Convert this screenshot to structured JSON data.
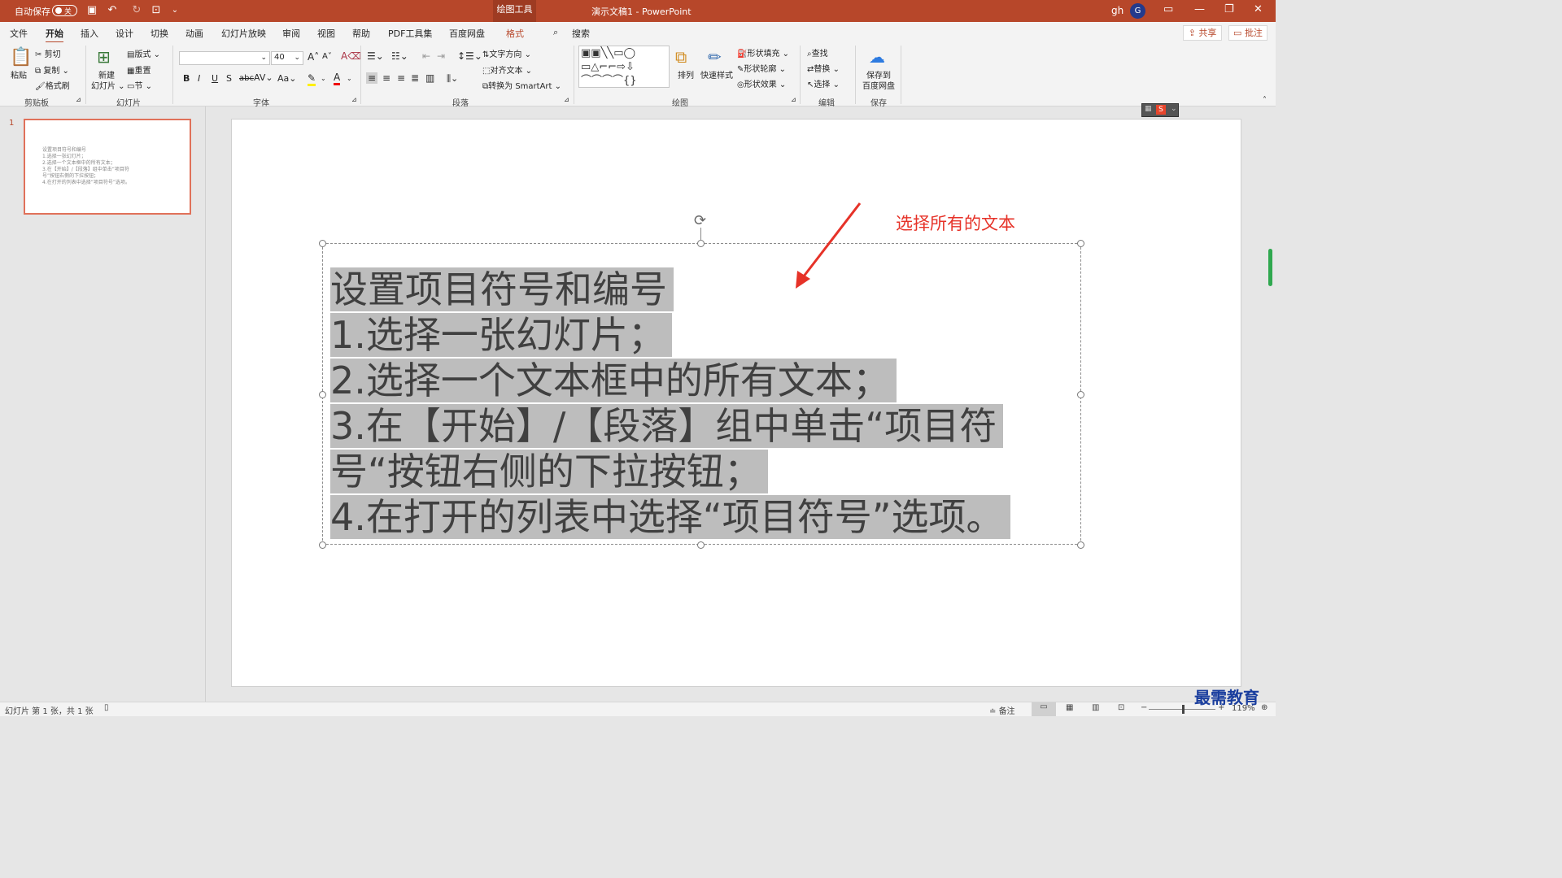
{
  "titlebar": {
    "autosave": "自动保存",
    "toggle": "关",
    "draw_tools": "绘图工具",
    "doc_title": "演示文稿1  -  PowerPoint",
    "user": "gh",
    "avatar": "G"
  },
  "tabs": [
    "文件",
    "开始",
    "插入",
    "设计",
    "切换",
    "动画",
    "幻灯片放映",
    "审阅",
    "视图",
    "帮助",
    "PDF工具集",
    "百度网盘",
    "格式"
  ],
  "search_label": "搜索",
  "share_label": "共享",
  "comment_label": "批注",
  "ribbon": {
    "clipboard": {
      "paste": "粘贴",
      "cut": "剪切",
      "copy": "复制",
      "format_painter": "格式刷",
      "group": "剪贴板"
    },
    "slides": {
      "new_slide_1": "新建",
      "new_slide_2": "幻灯片",
      "layout": "版式",
      "reset": "重置",
      "section": "节",
      "group": "幻灯片"
    },
    "font": {
      "size": "40",
      "group": "字体",
      "bold": "B",
      "italic": "I",
      "underline": "U",
      "shadow": "S",
      "strike": "abc",
      "spacing": "AV",
      "case": "Aa",
      "grow": "A",
      "shrink": "A"
    },
    "paragraph": {
      "text_direction": "文字方向",
      "align_text": "对齐文本",
      "smartart": "转换为 SmartArt",
      "group": "段落"
    },
    "drawing": {
      "arrange": "排列",
      "quick_styles": "快速样式",
      "fill": "形状填充",
      "outline": "形状轮廓",
      "effects": "形状效果",
      "group": "绘图"
    },
    "editing": {
      "find": "查找",
      "replace": "替换",
      "select": "选择",
      "group": "编辑"
    },
    "save": {
      "save_1": "保存到",
      "save_2": "百度网盘",
      "group": "保存"
    }
  },
  "thumbnail": {
    "number": "1",
    "lines": [
      "设置项目符号和编号",
      "1.选择一张幻灯片；",
      "2.选择一个文本框中的所有文本；",
      "3.在【开始】/【段落】组中单击“项目符",
      "号”按钮右侧的下拉按钮；",
      "4.在打开的列表中选择“项目符号”选项。"
    ]
  },
  "slide": {
    "lines": [
      "设置项目符号和编号",
      "1.选择一张幻灯片；",
      "2.选择一个文本框中的所有文本；",
      "3.在【开始】/【段落】组中单击“项目符",
      "号“按钮右侧的下拉按钮；",
      "4.在打开的列表中选择“项目符号”选项。"
    ],
    "annotation": "选择所有的文本"
  },
  "status": {
    "slide_info": "幻灯片 第 1 张，共 1 张",
    "notes": "备注",
    "zoom": "119%"
  },
  "watermark": "最需教育",
  "colors": {
    "accent": "#b7472a",
    "annotation": "#e63228",
    "selection": "#bdbdbd"
  }
}
